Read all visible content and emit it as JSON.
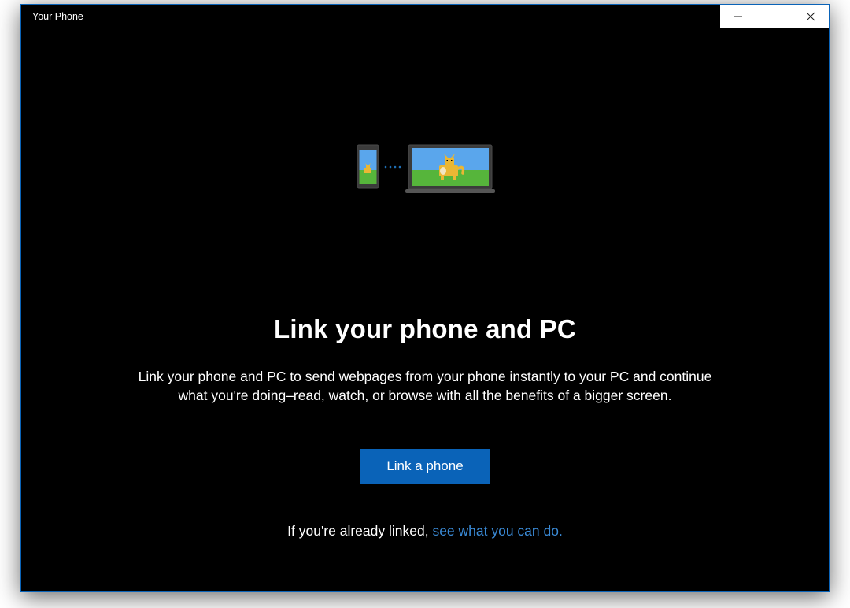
{
  "window": {
    "title": "Your Phone"
  },
  "content": {
    "heading": "Link your phone and PC",
    "subtext": "Link your phone and PC to send webpages from your phone instantly to your PC and continue what you're doing–read, watch, or browse with all the benefits of a bigger screen.",
    "primary_button": "Link a phone",
    "footer_prefix": "If you're already linked, ",
    "footer_link": "see what you can do."
  },
  "colors": {
    "accent": "#0a63b8",
    "link": "#3a8ad6",
    "window_bg": "#000000",
    "text": "#ffffff"
  },
  "icons": {
    "minimize": "minimize-icon",
    "maximize": "maximize-icon",
    "close": "close-icon",
    "illustration": "phone-laptop-cat-illustration"
  }
}
